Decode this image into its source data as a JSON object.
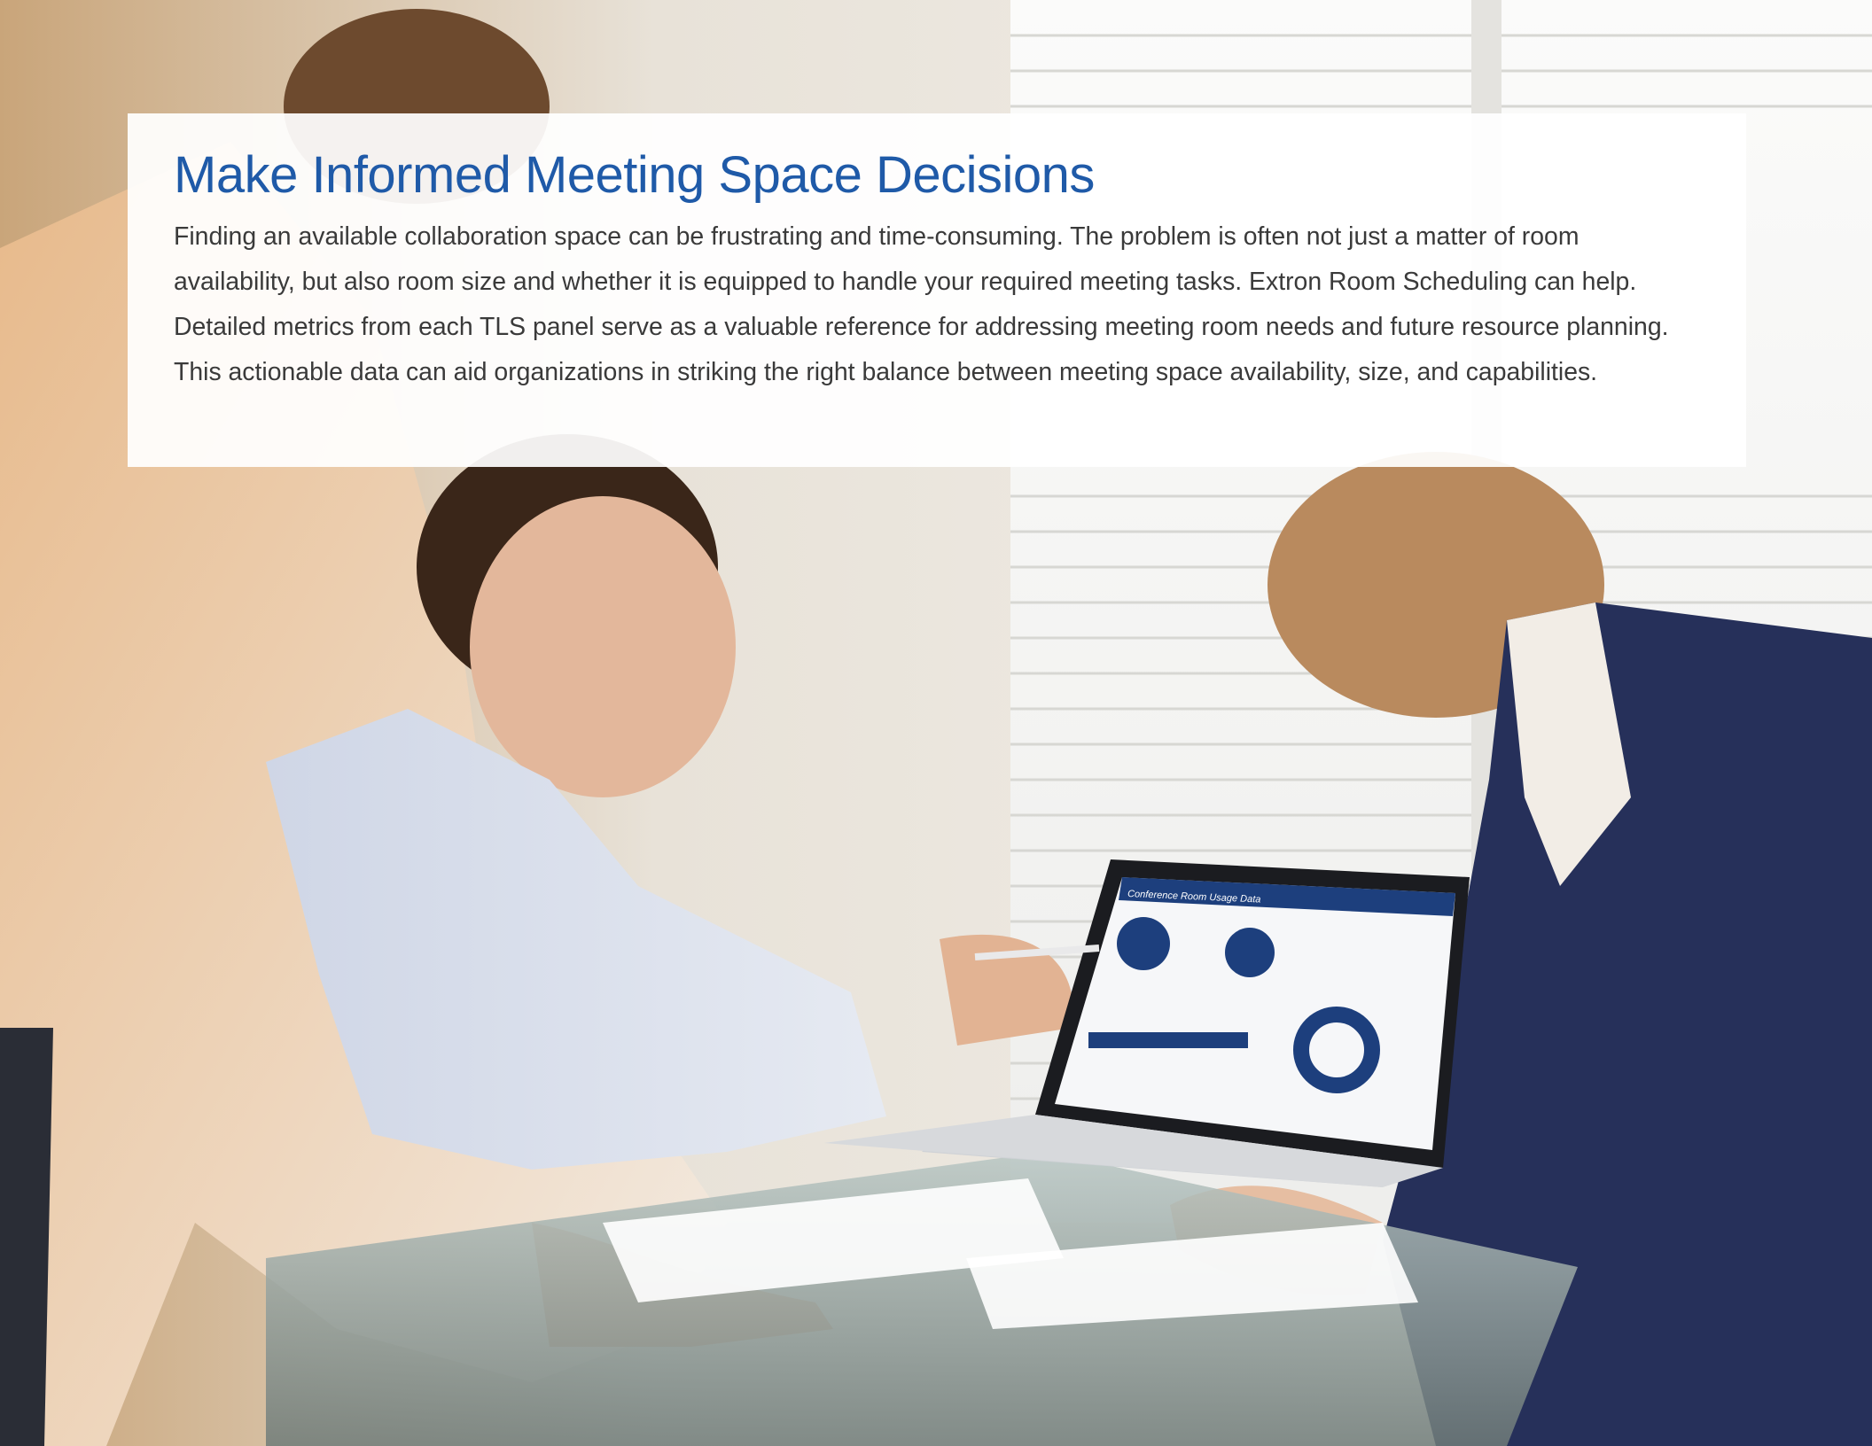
{
  "page": {
    "headline": "Make Informed Meeting Space Decisions",
    "body_text": "Finding an available collaboration space can be frustrating and time-consuming. The problem is often not just a matter of room availability, but also room size and whether it is equipped to handle your required meeting tasks. Extron Room Scheduling can help. Detailed metrics from each TLS panel serve as a valuable reference for addressing meeting room needs and future resource planning. This actionable data can aid organizations in striking the right balance between meeting space availability, size, and capabilities."
  },
  "photo": {
    "laptop_screen_title": "Conference Room Usage Data"
  },
  "colors": {
    "headline": "#1f5aa8",
    "body_text": "#3a3a3a",
    "panel_background": "#ffffff",
    "dashboard_accent": "#1d3f7d"
  }
}
